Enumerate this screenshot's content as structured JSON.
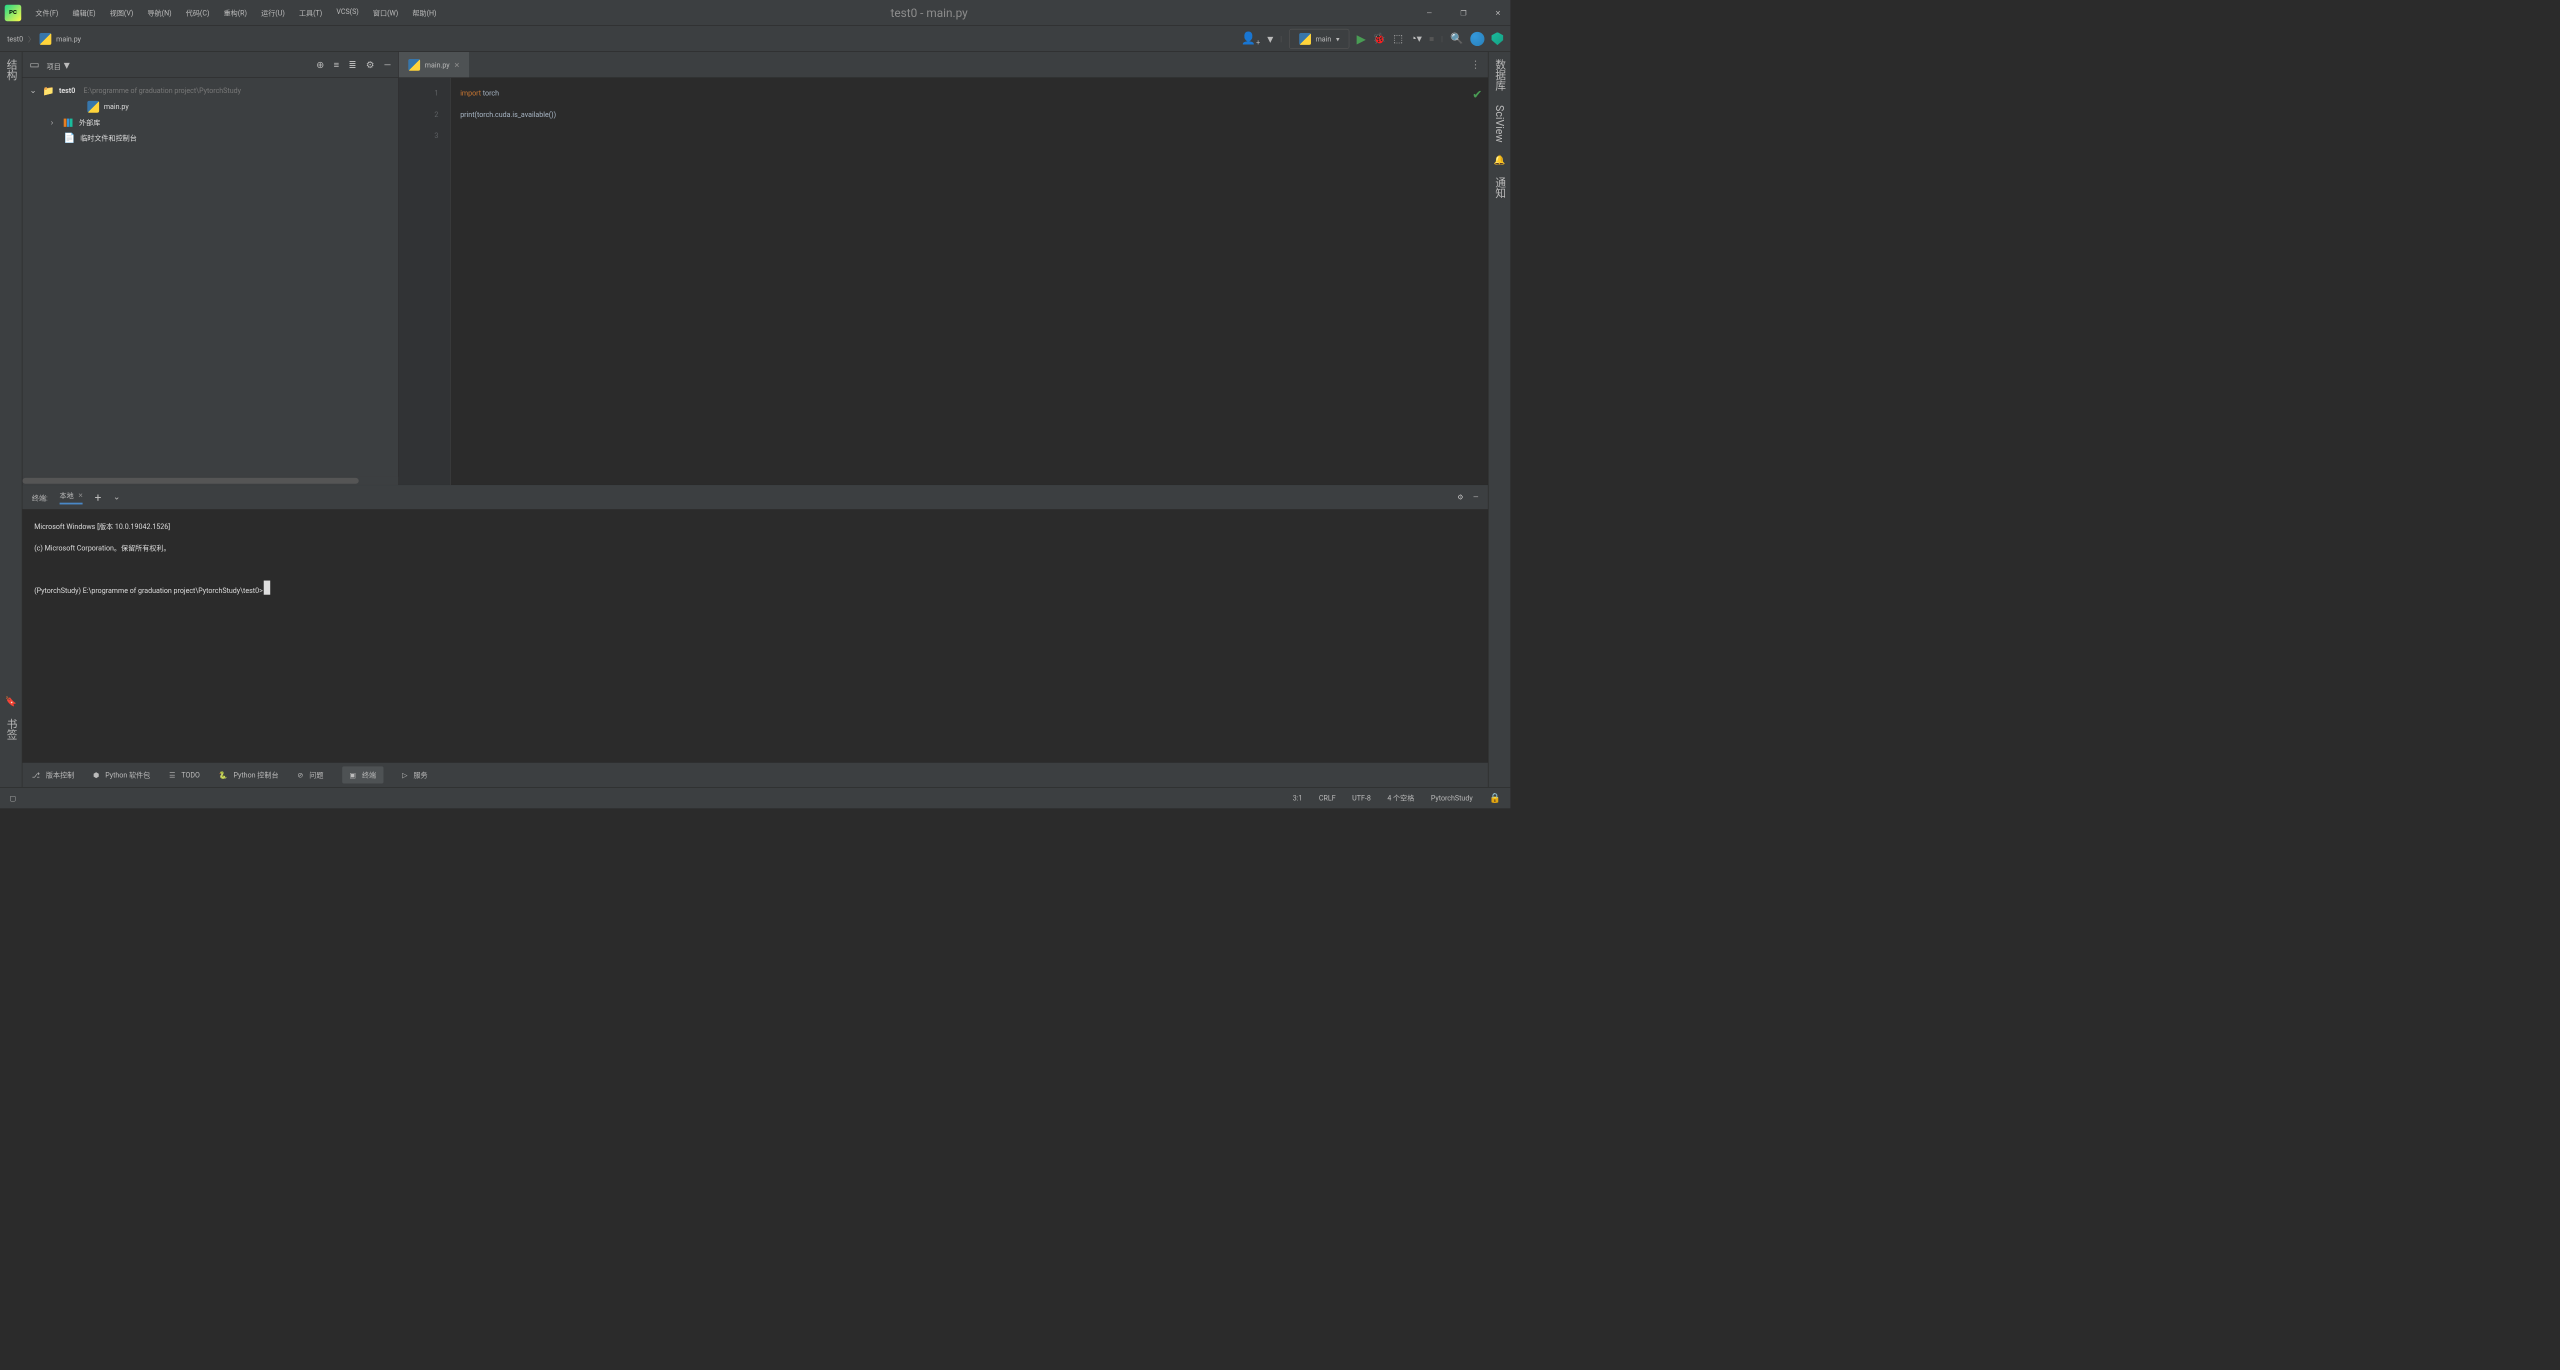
{
  "window": {
    "title": "test0 - main.py"
  },
  "menu": [
    "文件(F)",
    "编辑(E)",
    "视图(V)",
    "导航(N)",
    "代码(C)",
    "重构(R)",
    "运行(U)",
    "工具(T)",
    "VCS(S)",
    "窗口(W)",
    "帮助(H)"
  ],
  "breadcrumb": {
    "root": "test0",
    "file": "main.py"
  },
  "runConfig": {
    "label": "main"
  },
  "sidebar": {
    "title": "项目",
    "root": {
      "name": "test0",
      "path": "E:\\programme of graduation project\\PytorchStudy"
    },
    "file": "main.py",
    "libs": "外部库",
    "scratch": "临时文件和控制台"
  },
  "leftGutter": {
    "struct": "结构",
    "bookmark": "书签"
  },
  "rightGutter": {
    "notify": "通知",
    "sciview": "SciView",
    "database": "数据库"
  },
  "tab": {
    "name": "main.py"
  },
  "code": {
    "lines": [
      {
        "num": "1",
        "html": "<span class='kw'>import</span> torch"
      },
      {
        "num": "2",
        "html": "<span class='fn'>print</span>(torch.cuda.is_available())"
      },
      {
        "num": "3",
        "html": ""
      }
    ]
  },
  "terminal": {
    "title": "终端:",
    "tab": "本地",
    "lines": [
      "Microsoft Windows [版本 10.0.19042.1526]",
      "(c) Microsoft Corporation。保留所有权利。",
      "",
      "(PytorchStudy) E:\\programme of graduation project\\PytorchStudy\\test0>"
    ]
  },
  "bottomTabs": {
    "vcs": "版本控制",
    "packages": "Python 软件包",
    "todo": "TODO",
    "console": "Python 控制台",
    "problems": "问题",
    "terminal": "终端",
    "services": "服务"
  },
  "status": {
    "pos": "3:1",
    "crlf": "CRLF",
    "encoding": "UTF-8",
    "indent": "4 个空格",
    "interpreter": "PytorchStudy"
  }
}
